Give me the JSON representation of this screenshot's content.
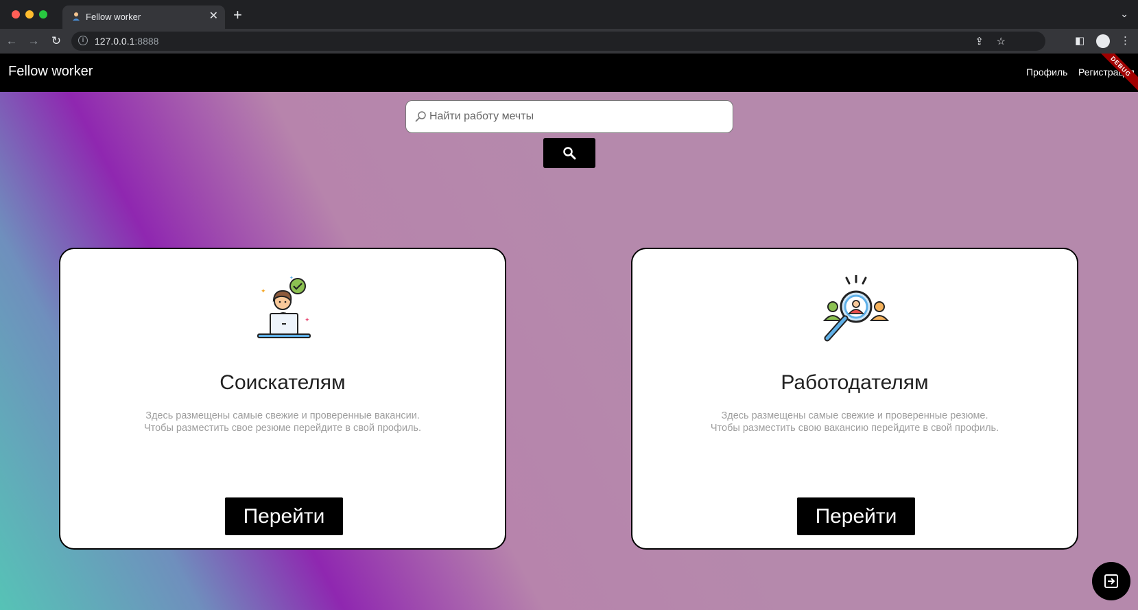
{
  "browser": {
    "tab_title": "Fellow worker",
    "url_host": "127.0.0.1",
    "url_port": ":8888"
  },
  "appbar": {
    "title": "Fellow worker",
    "nav_profile": "Профиль",
    "nav_register": "Регистрация",
    "debug_banner": "DEBUG"
  },
  "search": {
    "placeholder": "Найти работу мечты"
  },
  "cards": [
    {
      "title": "Соискателям",
      "description": "Здесь размещены самые свежие и проверенные вакансии.\nЧтобы разместить свое резюме перейдите в свой профиль.",
      "button": "Перейти",
      "icon": "job-seeker-laptop-icon"
    },
    {
      "title": "Работодателям",
      "description": "Здесь размещены самые свежие и проверенные резюме.\nЧтобы разместить свою вакансию перейдите в свой профиль.",
      "button": "Перейти",
      "icon": "magnifier-people-icon"
    }
  ],
  "fab": {
    "icon": "logout-icon"
  },
  "colors": {
    "appbar": "#000000",
    "card_bg": "#ffffff",
    "gradient_teal": "#56c3b6",
    "gradient_purple": "#8f27b0",
    "gradient_mauve": "#b589ac"
  }
}
